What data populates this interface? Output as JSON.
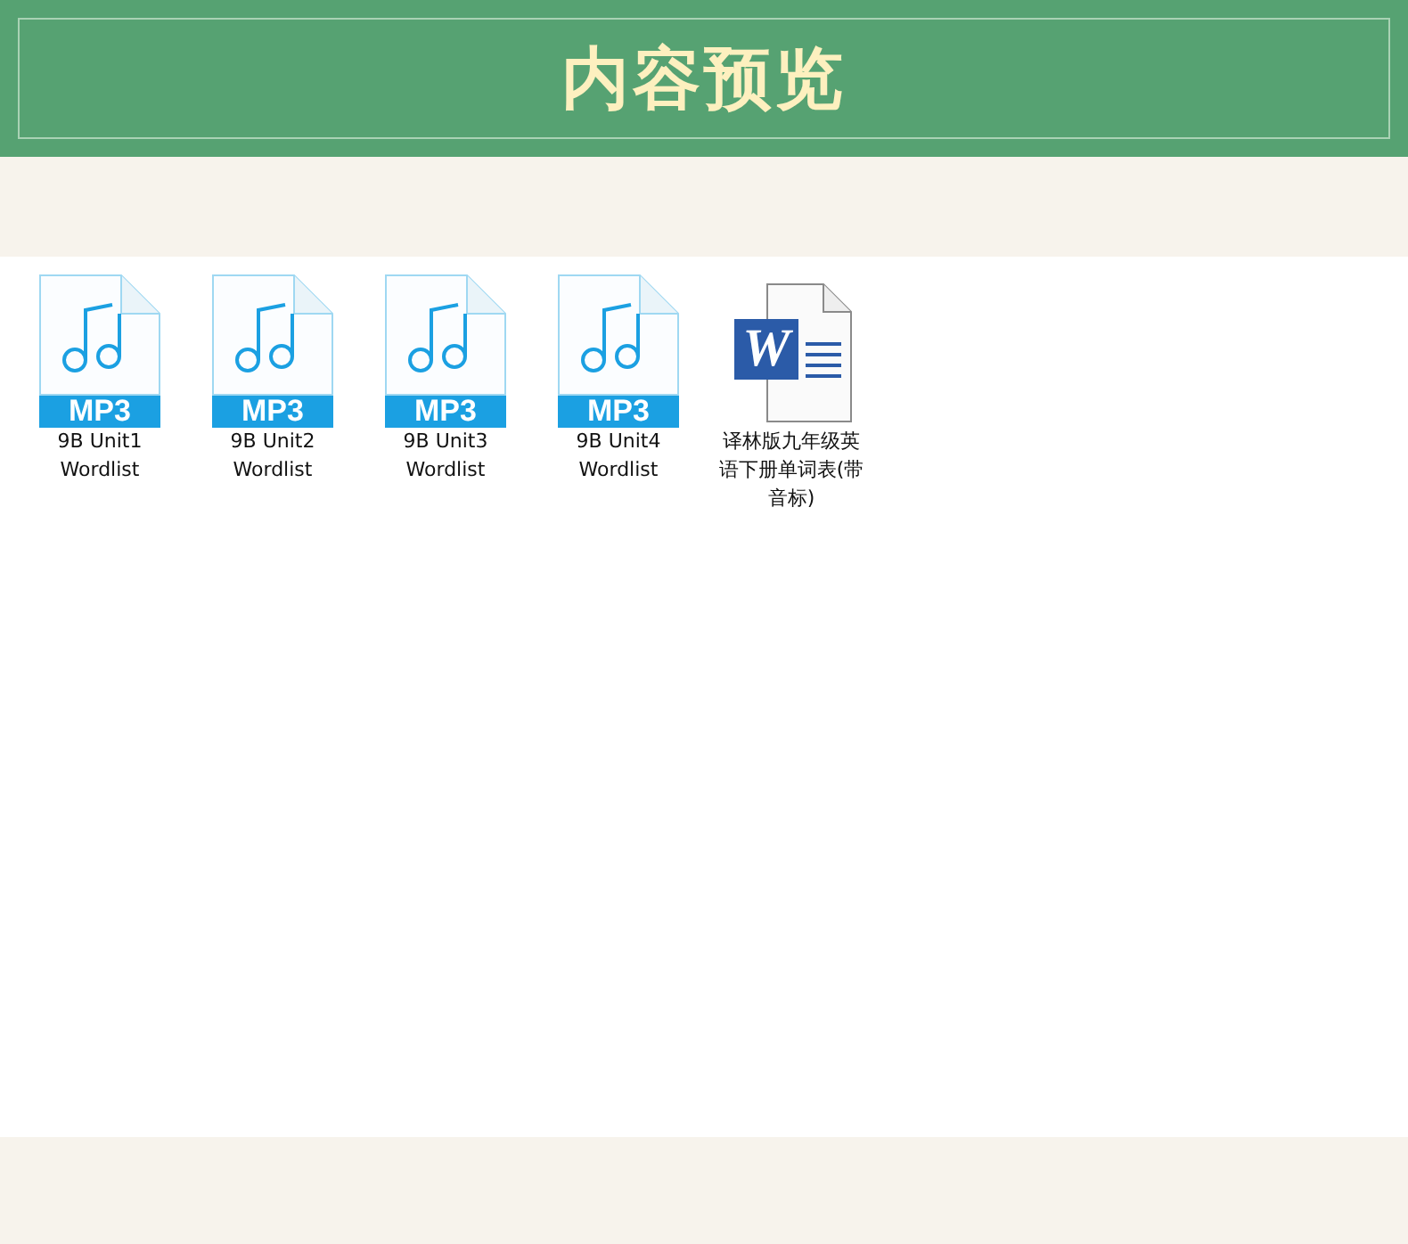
{
  "header": {
    "title": "内容预览"
  },
  "files": [
    {
      "kind": "mp3",
      "badge": "MP3",
      "name": "9B Unit1 Wordlist"
    },
    {
      "kind": "mp3",
      "badge": "MP3",
      "name": "9B Unit2 Wordlist"
    },
    {
      "kind": "mp3",
      "badge": "MP3",
      "name": "9B Unit3 Wordlist"
    },
    {
      "kind": "mp3",
      "badge": "MP3",
      "name": "9B Unit4 Wordlist"
    },
    {
      "kind": "word",
      "badge": "W",
      "name": "译林版九年级英语下册单词表(带音标)"
    }
  ]
}
